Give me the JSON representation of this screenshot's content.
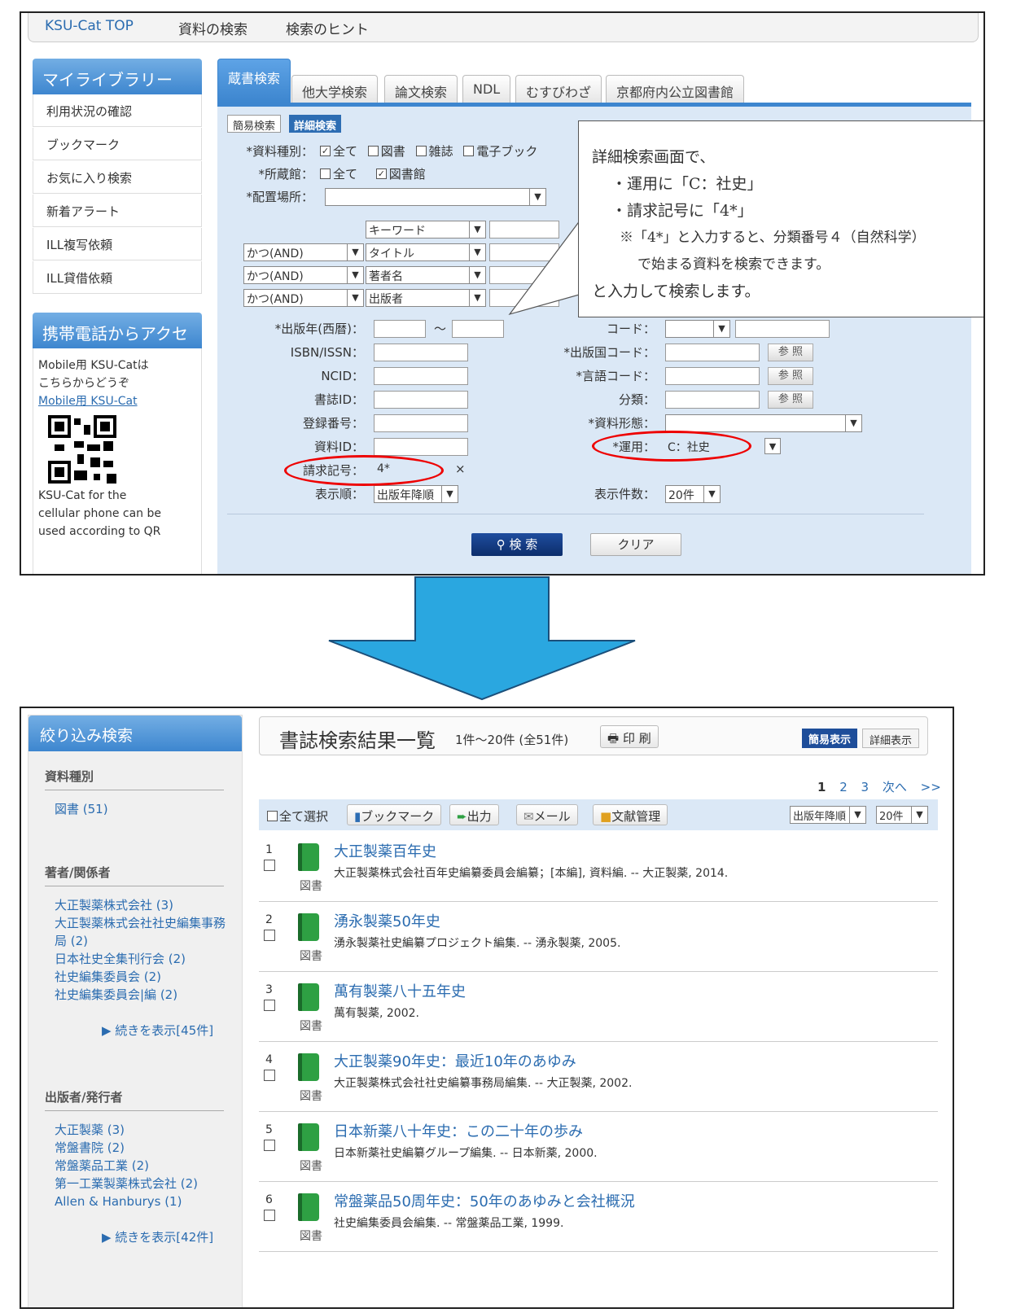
{
  "panel1": {
    "nav": [
      "KSU-Cat TOP",
      "資料の検索",
      "検索のヒント"
    ],
    "mylib_title": "マイライブラリー",
    "mylib_items": [
      "利用状況の確認",
      "ブックマーク",
      "お気に入り検索",
      "新着アラート",
      "ILL複写依頼",
      "ILL貸借依頼"
    ],
    "mobile_title": "携帯電話からアクセス",
    "mobile_text1": "Mobile用 KSU-Catは",
    "mobile_text2": "こちらからどうぞ",
    "mobile_link": "Mobile用 KSU-Cat",
    "mobile_en1": "KSU-Cat for the",
    "mobile_en2": "cellular phone can be",
    "mobile_en3": "used according to QR",
    "tabs": [
      "蔵書検索",
      "他大学検索",
      "論文検索",
      "NDL",
      "むすびわざ",
      "京都府内公立図書館"
    ],
    "subtabs": [
      "簡易検索",
      "詳細検索"
    ],
    "form": {
      "type_label": "*資料種別：",
      "type_opts": [
        "全て",
        "図書",
        "雑誌",
        "電子ブック"
      ],
      "lib_label": "*所蔵館：",
      "lib_opts": [
        "全て",
        "図書館"
      ],
      "loc_label": "*配置場所：",
      "kw": "キーワード",
      "and": "かつ(AND)",
      "title": "タイトル",
      "author": "著者名",
      "publisher": "出版者",
      "year_label": "*出版年(西暦)：",
      "tilde": "～",
      "isbn_label": "ISBN/ISSN：",
      "ncid_label": "NCID：",
      "bibid_label": "書誌ID：",
      "regno_label": "登録番号：",
      "matid_label": "資料ID：",
      "callno_label": "請求記号：",
      "callno_value": "4*",
      "clear_x": "×",
      "order_label": "表示順：",
      "order_value": "出版年降順",
      "code_label": "コード：",
      "country_label": "*出版国コード：",
      "lang_label": "*言語コード：",
      "class_label": "分類：",
      "form_label": "*資料形態：",
      "use_label": "*運用：",
      "use_value": "C：社史",
      "count_label": "表示件数：",
      "count_value": "20件",
      "ref": "参 照",
      "search_btn": "検 索",
      "clear_btn": "クリア"
    },
    "callout": [
      "詳細検索画面で、",
      "・運用に「C：社史」",
      "・請求記号に「4*」",
      "※「4*」と入力すると、分類番号４（自然科学）",
      "で始まる資料を検索できます。",
      "と入力して検索します。"
    ]
  },
  "arrow_color": "#2aa7e0",
  "panel2": {
    "filter_title": "絞り込み検索",
    "sec_type": "資料種別",
    "type_items": [
      "図書 (51)"
    ],
    "sec_author": "著者/関係者",
    "author_items": [
      "大正製薬株式会社 (3)",
      "大正製薬株式会社社史編集事務",
      "局 (2)",
      "日本社史全集刊行会 (2)",
      "社史編集委員会 (2)",
      "社史編集委員会|編 (2)"
    ],
    "author_more": "▶ 続きを表示[45件]",
    "sec_pub": "出版者/発行者",
    "pub_items": [
      "大正製薬 (3)",
      "常盤書院 (2)",
      "常盤薬品工業 (2)",
      "第一工業製薬株式会社 (2)",
      "Allen & Hanburys (1)"
    ],
    "pub_more": "▶ 続きを表示[42件]",
    "result_title": "書誌検索結果一覧",
    "result_range": "1件～20件 (全51件)",
    "print": "印 刷",
    "simple_view": "簡易表示",
    "detail_view": "詳細表示",
    "pages": [
      "1",
      "2",
      "3",
      "次へ",
      ">>"
    ],
    "select_all": "全て選択",
    "bookmark": "ブックマーク",
    "output": "出力",
    "mail": "メール",
    "refmgr": "文献管理",
    "sort": "出版年降順",
    "per_page": "20件",
    "results": [
      {
        "num": "1",
        "type": "図書",
        "title": "大正製薬百年史",
        "desc": "大正製薬株式会社百年史編纂委員会編纂；[本編], 資料編. -- 大正製薬, 2014."
      },
      {
        "num": "2",
        "type": "図書",
        "title": "湧永製薬50年史",
        "desc": "湧永製薬社史編纂プロジェクト編集. -- 湧永製薬, 2005."
      },
      {
        "num": "3",
        "type": "図書",
        "title": "萬有製薬八十五年史",
        "desc": "萬有製薬, 2002."
      },
      {
        "num": "4",
        "type": "図書",
        "title": "大正製薬90年史：最近10年のあゆみ",
        "desc": "大正製薬株式会社社史編纂事務局編集. -- 大正製薬, 2002."
      },
      {
        "num": "5",
        "type": "図書",
        "title": "日本新薬八十年史：この二十年の歩み",
        "desc": "日本新薬社史編纂グループ編集. -- 日本新薬, 2000."
      },
      {
        "num": "6",
        "type": "図書",
        "title": "常盤薬品50周年史：50年のあゆみと会社概況",
        "desc": "社史編集委員会編集. -- 常盤薬品工業, 1999."
      }
    ]
  }
}
